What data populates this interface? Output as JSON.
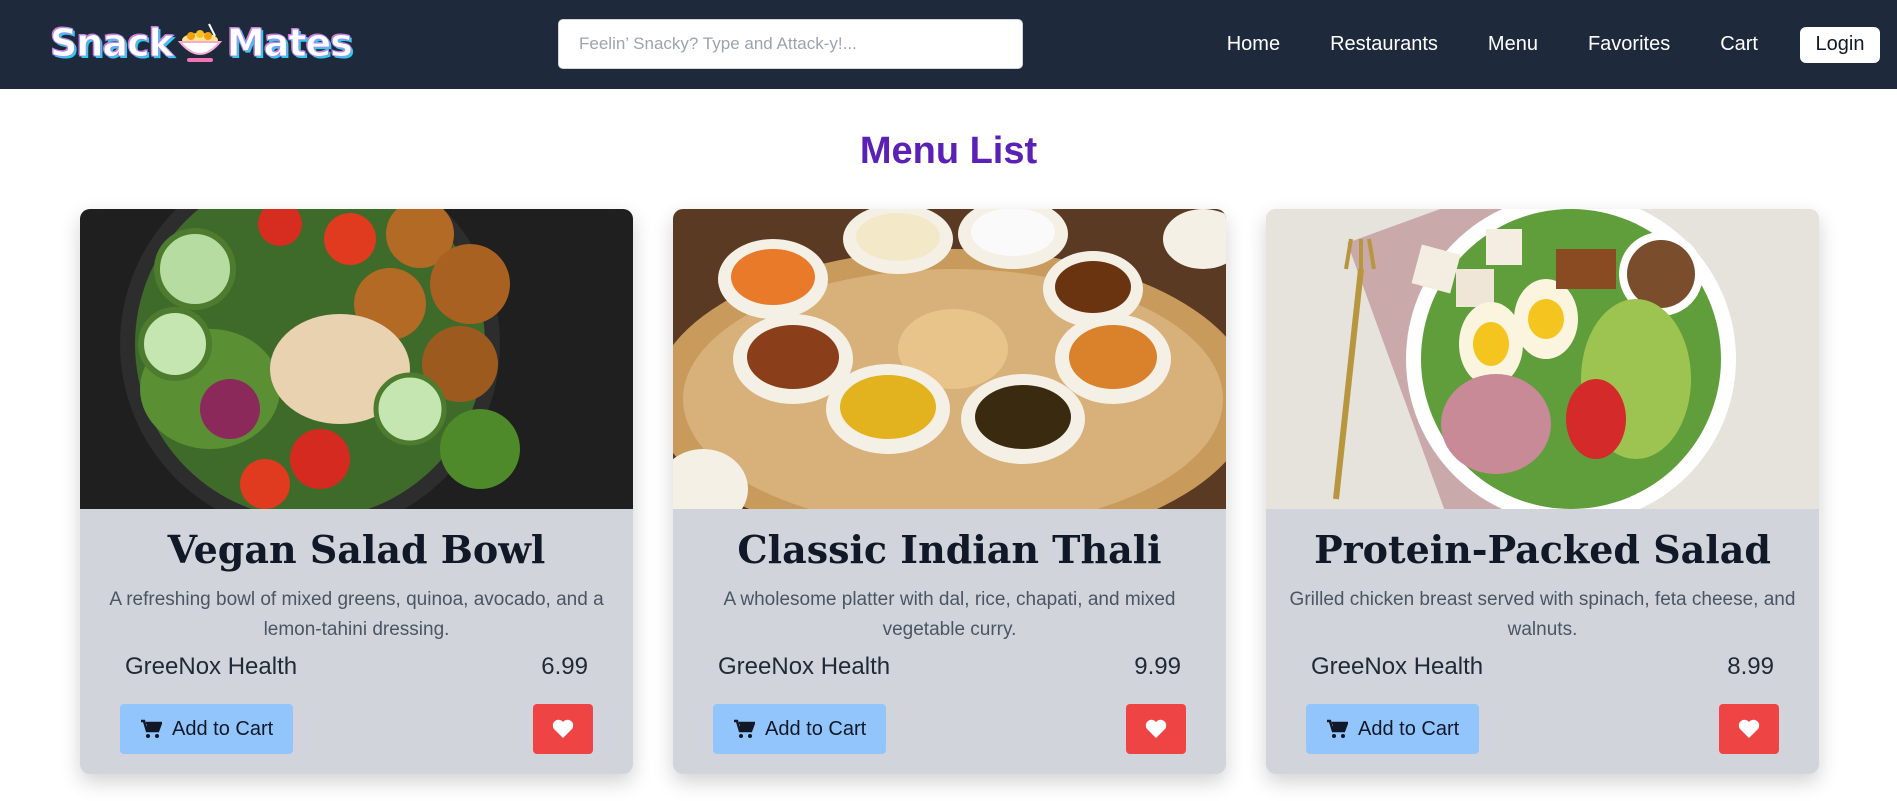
{
  "brand": {
    "name_left": "Snack",
    "name_right": "Mates"
  },
  "search": {
    "placeholder": "Feelin’ Snacky? Type and Attack-y!..."
  },
  "nav": {
    "items": [
      {
        "label": "Home"
      },
      {
        "label": "Restaurants"
      },
      {
        "label": "Menu"
      },
      {
        "label": "Favorites"
      },
      {
        "label": "Cart"
      }
    ],
    "login_label": "Login"
  },
  "page": {
    "title": "Menu List"
  },
  "colors": {
    "navbar": "#1e293b",
    "title": "#5b21b6",
    "card_bg": "#d1d5db",
    "cart_button": "#93c5fd",
    "favorite_button": "#ef4444"
  },
  "icons": {
    "cart": "cart-icon",
    "favorite": "heart-icon"
  },
  "cards": [
    {
      "title": "Vegan Salad Bowl",
      "description": "A refreshing bowl of mixed greens, quinoa, avocado, and a lemon-tahini dressing.",
      "restaurant": "GreeNox Health",
      "price": "6.99",
      "add_to_cart_label": "Add to Cart"
    },
    {
      "title": "Classic Indian Thali",
      "description": "A wholesome platter with dal, rice, chapati, and mixed vegetable curry.",
      "restaurant": "GreeNox Health",
      "price": "9.99",
      "add_to_cart_label": "Add to Cart"
    },
    {
      "title": "Protein-Packed Salad",
      "description": "Grilled chicken breast served with spinach, feta cheese, and walnuts.",
      "restaurant": "GreeNox Health",
      "price": "8.99",
      "add_to_cart_label": "Add to Cart"
    }
  ]
}
